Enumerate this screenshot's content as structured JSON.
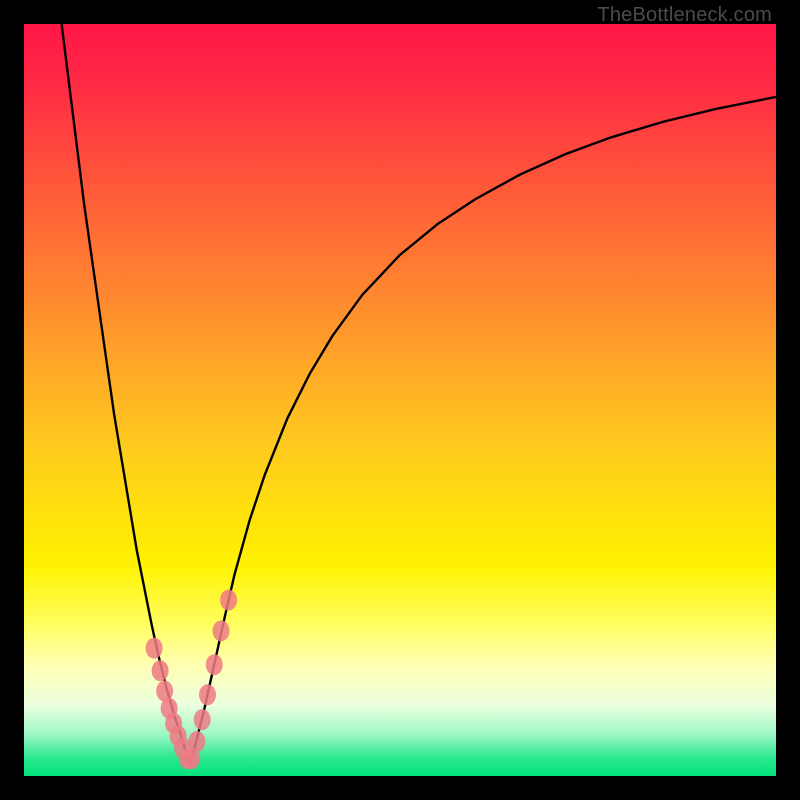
{
  "watermark": "TheBottleneck.com",
  "colors": {
    "frame": "#000000",
    "curve": "#000000",
    "marker_fill": "#ef7a84",
    "gradient_stops": [
      {
        "offset": 0.0,
        "color": "#ff1648"
      },
      {
        "offset": 0.08,
        "color": "#ff2a44"
      },
      {
        "offset": 0.22,
        "color": "#ff5a39"
      },
      {
        "offset": 0.38,
        "color": "#ff8e2e"
      },
      {
        "offset": 0.55,
        "color": "#ffc71f"
      },
      {
        "offset": 0.72,
        "color": "#fff200"
      },
      {
        "offset": 0.8,
        "color": "#ffff63"
      },
      {
        "offset": 0.85,
        "color": "#ffffb0"
      },
      {
        "offset": 0.905,
        "color": "#ecffde"
      },
      {
        "offset": 0.945,
        "color": "#9cf7c3"
      },
      {
        "offset": 0.975,
        "color": "#2fe890"
      },
      {
        "offset": 1.0,
        "color": "#00e27a"
      }
    ]
  },
  "chart_data": {
    "type": "line",
    "title": "",
    "xlabel": "",
    "ylabel": "",
    "xlim": [
      0,
      100
    ],
    "ylim": [
      0,
      100
    ],
    "grid": false,
    "legend": false,
    "series": [
      {
        "name": "bottleneck-curve-left",
        "x": [
          5,
          6,
          7,
          8,
          9,
          10,
          11,
          12,
          13,
          14,
          15,
          16,
          17,
          18,
          19,
          20,
          21,
          21.5,
          22
        ],
        "y": [
          100,
          92,
          84,
          76,
          69,
          62,
          55,
          48,
          42,
          36,
          30,
          25,
          20,
          15.5,
          11.5,
          8,
          5,
          3.2,
          1.5
        ]
      },
      {
        "name": "bottleneck-curve-right",
        "x": [
          22,
          22.5,
          23,
          24,
          25,
          26,
          27,
          28,
          30,
          32,
          35,
          38,
          41,
          45,
          50,
          55,
          60,
          66,
          72,
          78,
          85,
          92,
          100
        ],
        "y": [
          1.5,
          3,
          5,
          9,
          13.5,
          18,
          22.5,
          26.8,
          34,
          40,
          47.5,
          53.5,
          58.5,
          64,
          69.3,
          73.4,
          76.7,
          80,
          82.7,
          84.9,
          87,
          88.7,
          90.3
        ]
      },
      {
        "name": "highlighted-points",
        "mode": "markers",
        "x": [
          17.3,
          18.1,
          18.7,
          19.3,
          19.9,
          20.5,
          21.1,
          21.7,
          22.3,
          23.0,
          23.7,
          24.4,
          25.3,
          26.2,
          27.2
        ],
        "y": [
          17.0,
          14.0,
          11.3,
          9.0,
          7.0,
          5.3,
          3.7,
          2.3,
          2.3,
          4.6,
          7.5,
          10.8,
          14.8,
          19.3,
          23.4
        ]
      }
    ]
  }
}
